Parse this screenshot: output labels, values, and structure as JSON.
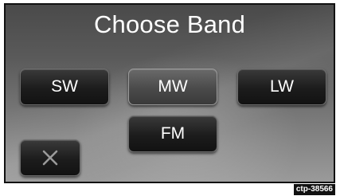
{
  "screen": {
    "title": "Choose Band"
  },
  "bands": [
    {
      "label": "SW",
      "selected": false
    },
    {
      "label": "MW",
      "selected": true
    },
    {
      "label": "LW",
      "selected": false
    },
    {
      "label": "FM",
      "selected": false
    }
  ],
  "close_button": {
    "icon": "close-icon"
  },
  "figure_code": "ctp-38566",
  "colors": {
    "button_text": "#ffffff",
    "button_bg": "#1c1c1c",
    "selected_button_bg": "#4a4a4a",
    "close_icon": "#9a9a9a"
  }
}
